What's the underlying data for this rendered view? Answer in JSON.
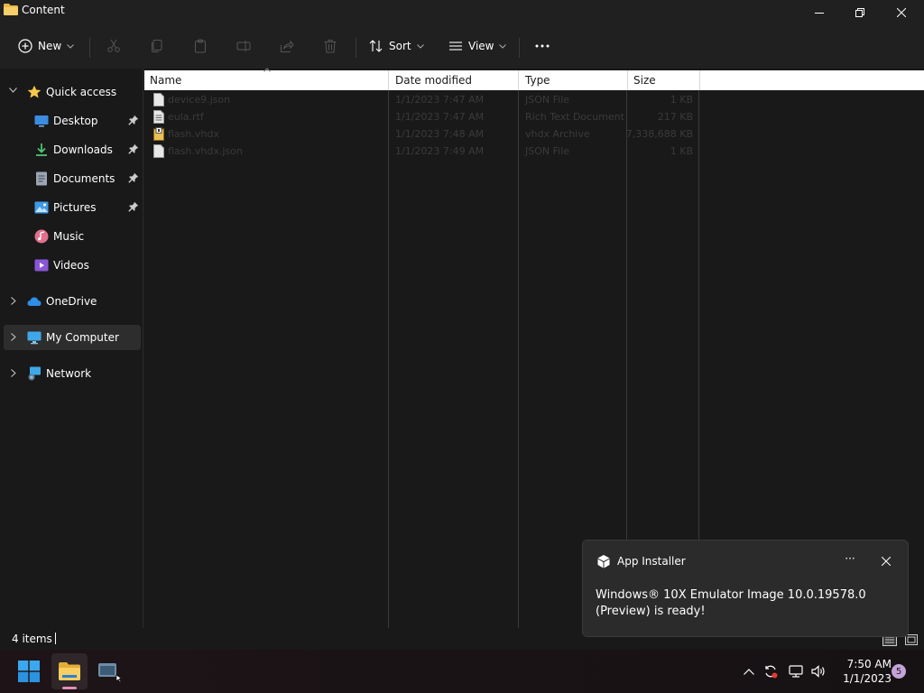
{
  "window": {
    "title": "Content"
  },
  "toolbar": {
    "new_label": "New",
    "sort_label": "Sort",
    "view_label": "View",
    "more_label": "···"
  },
  "nav": {
    "quick_access": "Quick access",
    "desktop": "Desktop",
    "downloads": "Downloads",
    "documents": "Documents",
    "pictures": "Pictures",
    "music": "Music",
    "videos": "Videos",
    "onedrive": "OneDrive",
    "my_computer": "My Computer",
    "network": "Network"
  },
  "columns": {
    "name": "Name",
    "date": "Date modified",
    "type": "Type",
    "size": "Size"
  },
  "files": [
    {
      "name": "device9.json",
      "date": "1/1/2023 7:47 AM",
      "type": "JSON File",
      "size": "1 KB"
    },
    {
      "name": "eula.rtf",
      "date": "1/1/2023 7:47 AM",
      "type": "Rich Text Document",
      "size": "217 KB"
    },
    {
      "name": "flash.vhdx",
      "date": "1/1/2023 7:48 AM",
      "type": "vhdx Archive",
      "size": "7,338,688 KB"
    },
    {
      "name": "flash.vhdx.json",
      "date": "1/1/2023 7:49 AM",
      "type": "JSON File",
      "size": "1 KB"
    }
  ],
  "status": {
    "items": "4 items"
  },
  "toast": {
    "app": "App Installer",
    "more": "···",
    "message": "Windows® 10X Emulator Image 10.0.19578.0 (Preview) is ready!"
  },
  "clock": {
    "time": "7:50 AM",
    "date": "1/1/2023"
  },
  "notifications": {
    "count": "5"
  },
  "colors": {
    "accent": "#0078d4",
    "window_bg": "#191919",
    "folder": "#f2c14e"
  }
}
